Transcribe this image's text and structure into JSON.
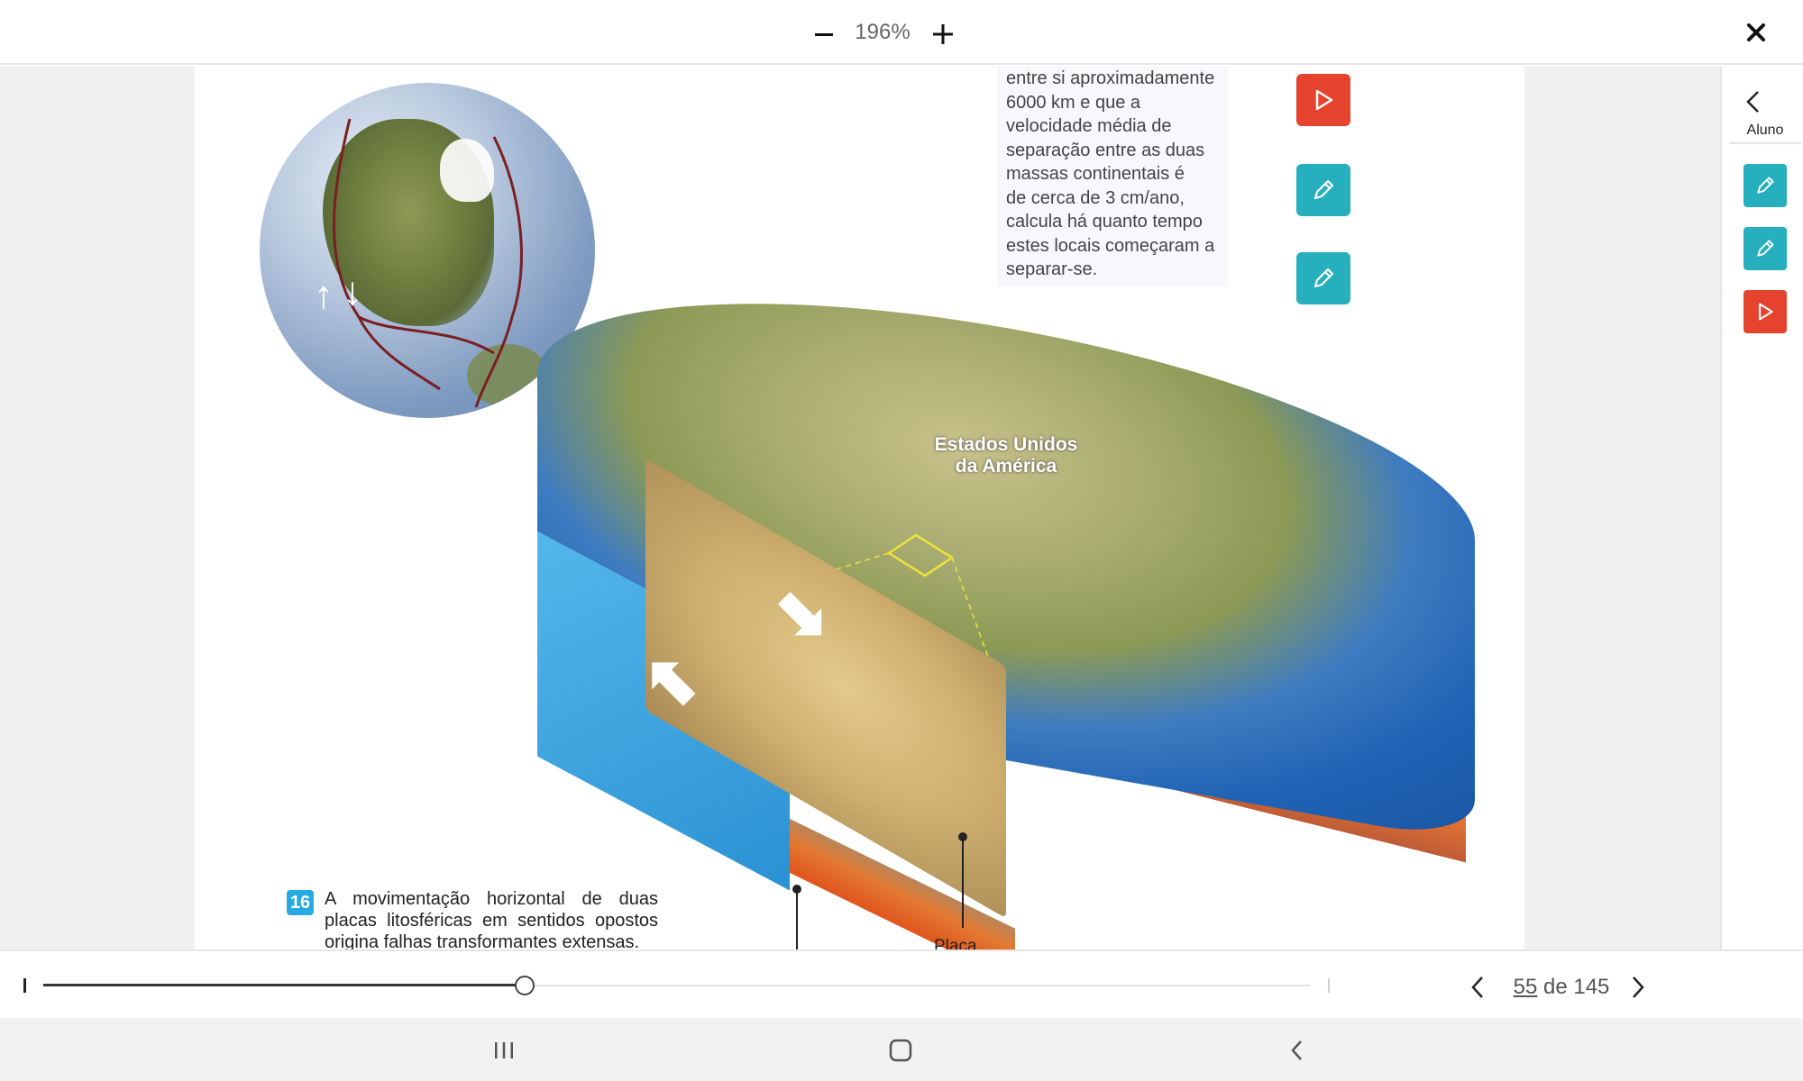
{
  "toolbar": {
    "zoom_level": "196%",
    "zoom_out_icon": "minus-icon",
    "zoom_in_icon": "plus-icon",
    "close_icon": "close-icon"
  },
  "page": {
    "question_text": "entre si aproximadamente\n6000 km e que a\nvelocidade média de\nseparação entre as duas\nmassas continentais é\nde cerca de 3 cm/ano,\ncalcula há quanto tempo\nestes locais começaram a\nseparar-se.",
    "map_label_line1": "Estados Unidos",
    "map_label_line2": "da América",
    "figure_number": "16",
    "caption_text": "A movimentação horizontal de duas placas litosféricas em sentidos opostos origina falhas transformantes extensas.",
    "plate_label": "Placa",
    "actions": [
      {
        "type": "play",
        "icon": "play-icon",
        "color": "#e5432e"
      },
      {
        "type": "edit",
        "icon": "pencil-icon",
        "color": "#26afbd"
      },
      {
        "type": "edit",
        "icon": "pencil-icon",
        "color": "#26afbd"
      }
    ]
  },
  "side_panel": {
    "label": "Aluno",
    "back_icon": "chevron-left-icon",
    "actions": [
      {
        "type": "edit",
        "icon": "pencil-icon",
        "color": "#26afbd"
      },
      {
        "type": "edit",
        "icon": "pencil-icon",
        "color": "#26afbd"
      },
      {
        "type": "play",
        "icon": "play-icon",
        "color": "#e5432e"
      }
    ]
  },
  "pagination": {
    "current": "55",
    "separator": " de ",
    "total": "145",
    "progress": 0.38
  },
  "system_nav": {
    "recents_icon": "recents-icon",
    "home_icon": "home-icon",
    "back_icon": "back-icon"
  }
}
